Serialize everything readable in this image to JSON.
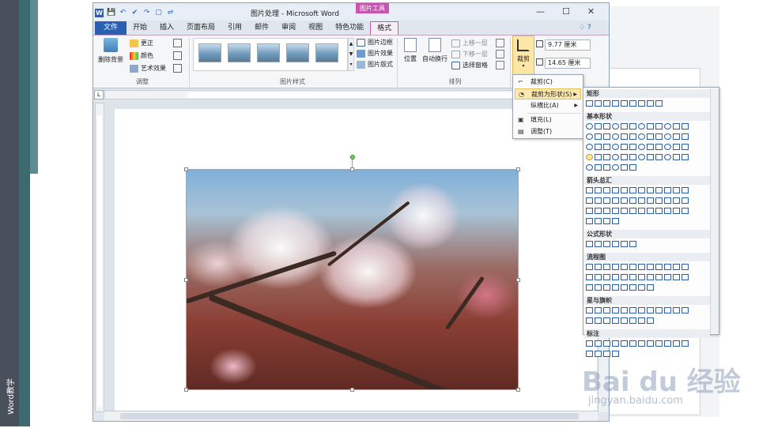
{
  "slide": {
    "side_text": "Word教学"
  },
  "window": {
    "title": "图片处理 - Microsoft Word",
    "tool_tab": "图片工具",
    "qat": [
      "W",
      "💾",
      "↶",
      "✔",
      "↷",
      "▢",
      "⇌"
    ],
    "controls": [
      "—",
      "☐",
      "✕"
    ]
  },
  "tabs": [
    "文件",
    "开始",
    "插入",
    "页面布局",
    "引用",
    "邮件",
    "审阅",
    "视图",
    "特色功能",
    "格式"
  ],
  "tabs_right": "♢ ?",
  "ribbon": {
    "adjust": {
      "remove_bg": "删除背景",
      "correct": "更正",
      "color": "颜色",
      "art": "艺术效果",
      "label": "调整"
    },
    "styles": {
      "label": "图片样式",
      "border": "图片边框",
      "effects": "图片效果",
      "layout": "图片版式"
    },
    "arrange": {
      "label": "排列",
      "position": "位置",
      "wrap": "自动换行",
      "forward": "上移一层",
      "backward": "下移一层",
      "pane": "选择窗格"
    },
    "size": {
      "crop": "裁剪",
      "height": "9.77 厘米",
      "width": "14.65 厘米"
    }
  },
  "crop_menu": [
    {
      "label": "裁剪(C)",
      "icon": "crop-icon",
      "submenu": false,
      "highlight": false
    },
    {
      "label": "裁剪为形状(S)",
      "icon": "shape-icon",
      "submenu": true,
      "highlight": true
    },
    {
      "label": "纵横比(A)",
      "icon": "",
      "submenu": true,
      "highlight": false
    },
    {
      "label": "填充(L)",
      "icon": "fill-icon",
      "submenu": false,
      "highlight": false
    },
    {
      "label": "调整(T)",
      "icon": "fit-icon",
      "submenu": false,
      "highlight": false
    }
  ],
  "shape_gallery": {
    "sections": [
      {
        "title": "矩形",
        "rows": [
          9
        ]
      },
      {
        "title": "基本形状",
        "rows": [
          12,
          12,
          12,
          12,
          6
        ]
      },
      {
        "title": "箭头总汇",
        "rows": [
          12,
          12,
          12,
          4
        ]
      },
      {
        "title": "公式形状",
        "rows": [
          6
        ]
      },
      {
        "title": "流程图",
        "rows": [
          12,
          12,
          8
        ]
      },
      {
        "title": "星与旗帜",
        "rows": [
          12,
          8
        ]
      },
      {
        "title": "标注",
        "rows": [
          12,
          4
        ]
      }
    ]
  },
  "watermark": {
    "brand": "Bai du 经验",
    "url": "jingyan.baidu.com"
  }
}
